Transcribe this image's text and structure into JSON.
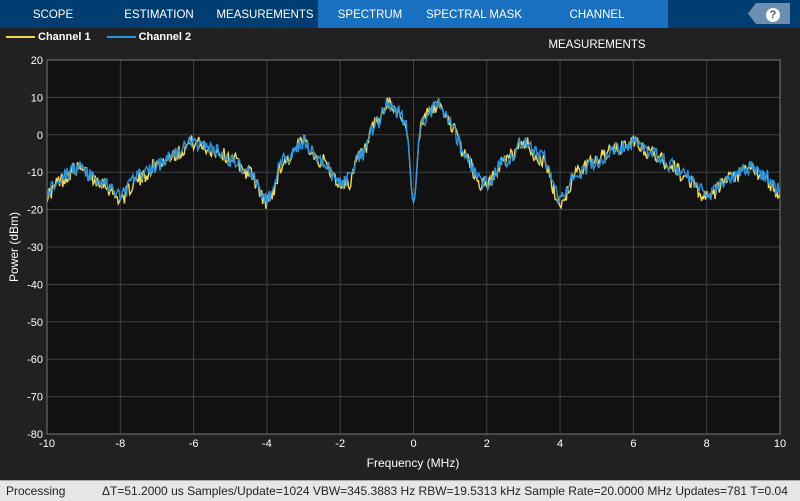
{
  "tabs": [
    {
      "label": "SCOPE",
      "style": "dark"
    },
    {
      "label": "ESTIMATION",
      "style": "dark"
    },
    {
      "label": "MEASUREMENTS",
      "style": "dark"
    },
    {
      "label": "SPECTRUM",
      "style": "light"
    },
    {
      "label": "SPECTRAL MASK",
      "style": "light"
    },
    {
      "label": "CHANNEL MEASUREMENTS",
      "style": "light"
    }
  ],
  "help": {
    "icon": "help-icon",
    "label": "?"
  },
  "status": {
    "state": "Processing",
    "info": "ΔT=51.2000 us  Samples/Update=1024  VBW=345.3883 Hz  RBW=19.5313 kHz  Sample Rate=20.0000 MHz  Updates=781  T=0.04"
  },
  "chart_data": {
    "type": "line",
    "xlabel": "Frequency (MHz)",
    "ylabel": "Power (dBm)",
    "xlim": [
      -10,
      10
    ],
    "ylim": [
      -80,
      20
    ],
    "xticks": [
      -10,
      -8,
      -6,
      -4,
      -2,
      0,
      2,
      4,
      6,
      8,
      10
    ],
    "yticks": [
      20,
      10,
      0,
      -10,
      -20,
      -30,
      -40,
      -50,
      -60,
      -70,
      -80
    ],
    "grid": true,
    "legend_placement": "top-left",
    "series": [
      {
        "name": "Channel 1",
        "color": "#f2d94e",
        "x": [
          -10,
          -9.6,
          -9.2,
          -8.6,
          -8,
          -7.5,
          -7,
          -6.5,
          -6,
          -5.5,
          -5,
          -4.5,
          -4,
          -3.5,
          -3,
          -2.5,
          -2,
          -1.8,
          -1.4,
          -1,
          -0.7,
          -0.4,
          -0.2,
          0,
          0.2,
          0.4,
          0.7,
          1,
          1.4,
          1.8,
          2,
          2.5,
          3,
          3.5,
          4,
          4.5,
          5,
          5.5,
          6,
          6.5,
          7,
          7.5,
          8,
          8.6,
          9.2,
          9.6,
          10
        ],
        "y": [
          -16,
          -12,
          -9,
          -12,
          -17,
          -12,
          -8,
          -5,
          -2,
          -4,
          -6,
          -10,
          -18,
          -7,
          -2,
          -7,
          -13,
          -13,
          -5,
          3,
          8,
          6,
          2,
          -18,
          2,
          6,
          8,
          3,
          -5,
          -13,
          -13,
          -7,
          -2,
          -7,
          -18,
          -10,
          -6,
          -4,
          -2,
          -5,
          -8,
          -12,
          -17,
          -12,
          -9,
          -12,
          -16
        ]
      },
      {
        "name": "Channel 2",
        "color": "#2b95df",
        "x": [
          -10,
          -9.6,
          -9.2,
          -8.6,
          -8,
          -7.5,
          -7,
          -6.5,
          -6,
          -5.5,
          -5,
          -4.5,
          -4,
          -3.5,
          -3,
          -2.5,
          -2,
          -1.8,
          -1.4,
          -1,
          -0.7,
          -0.4,
          -0.2,
          0,
          0.2,
          0.4,
          0.7,
          1,
          1.4,
          1.8,
          2,
          2.5,
          3,
          3.5,
          4,
          4.5,
          5,
          5.5,
          6,
          6.5,
          7,
          7.5,
          8,
          8.6,
          9.2,
          9.6,
          10
        ],
        "y": [
          -15,
          -11,
          -9,
          -12,
          -16,
          -11,
          -8,
          -5,
          -2,
          -4,
          -7,
          -10,
          -17,
          -6,
          -2,
          -7,
          -13,
          -12,
          -5,
          3,
          8,
          6,
          2,
          -18,
          2,
          6,
          8,
          3,
          -5,
          -12,
          -13,
          -7,
          -2,
          -6,
          -17,
          -10,
          -7,
          -4,
          -2,
          -5,
          -8,
          -11,
          -16,
          -12,
          -9,
          -11,
          -15
        ]
      }
    ]
  }
}
